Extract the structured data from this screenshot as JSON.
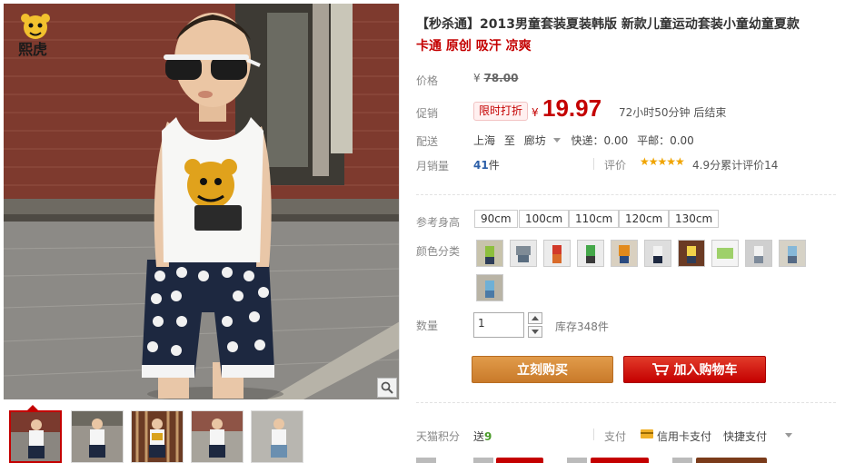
{
  "product": {
    "title": "【秒杀通】2013男童套装夏装韩版 新款儿童运动套装小童幼童夏款",
    "subtitle": "卡通 原创 吸汗 凉爽"
  },
  "price": {
    "label": "价格",
    "currency": "¥",
    "original": "78.00"
  },
  "promo": {
    "label": "促销",
    "badge": "限时打折",
    "currency": "¥",
    "price": "19.97",
    "countdown": "72小时50分钟 后结束"
  },
  "shipping": {
    "label": "配送",
    "from": "上海",
    "to_word": "至",
    "destination": "廊坊",
    "express": "快递：0.00",
    "surface": "平邮：0.00"
  },
  "sales": {
    "label": "月销量",
    "count": "41",
    "unit": "件"
  },
  "rating": {
    "label": "评价",
    "stars": "★★★★★",
    "text": "4.9分累计评价14"
  },
  "size": {
    "label": "参考身高",
    "options": [
      "90cm",
      "100cm",
      "110cm",
      "120cm",
      "130cm"
    ]
  },
  "color": {
    "label": "颜色分类",
    "option_count": 11
  },
  "quantity": {
    "label": "数量",
    "value": "1",
    "stock": "库存348件"
  },
  "actions": {
    "buy_now": "立刻购买",
    "add_to_cart": "加入购物车"
  },
  "points": {
    "label": "天猫积分",
    "prefix": "送",
    "value": "9"
  },
  "payment": {
    "label": "支付",
    "card": "信用卡支付",
    "quick": "快捷支付"
  },
  "brand_logo_text": "熙虎"
}
